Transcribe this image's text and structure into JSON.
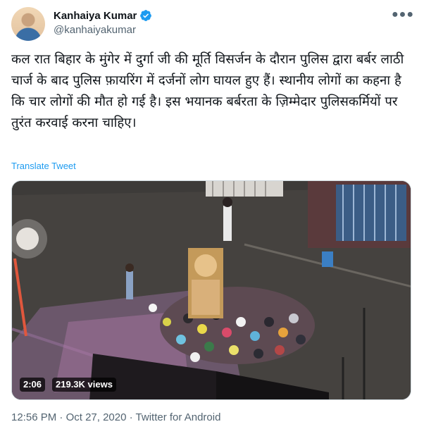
{
  "author": {
    "display_name": "Kanhaiya Kumar",
    "handle": "@kanhaiyakumar",
    "verified": true
  },
  "menu_icon": "more-icon",
  "tweet": {
    "text": "कल रात बिहार के मुंगेर में दुर्गा जी की मूर्ति विसर्जन के दौरान पुलिस द्वारा बर्बर लाठी चार्ज के बाद पुलिस फ़ायरिंग में दर्जनों लोग घायल हुए हैं। स्थानीय लोगों का कहना है कि चार लोगों की मौत हो गई है। इस भयानक बर्बरता के ज़िम्मेदार पुलिसकर्मियों पर तुरंत करवाई करना चाहिए।",
    "translate_label": "Translate Tweet"
  },
  "video": {
    "duration": "2:06",
    "views": "219.3K views"
  },
  "meta": {
    "time": "12:56 PM",
    "date": "Oct 27, 2020",
    "source": "Twitter for Android",
    "separator": "·"
  },
  "colors": {
    "link": "#1d9bf0",
    "secondary_text": "#536471",
    "primary_text": "#0f1419"
  }
}
